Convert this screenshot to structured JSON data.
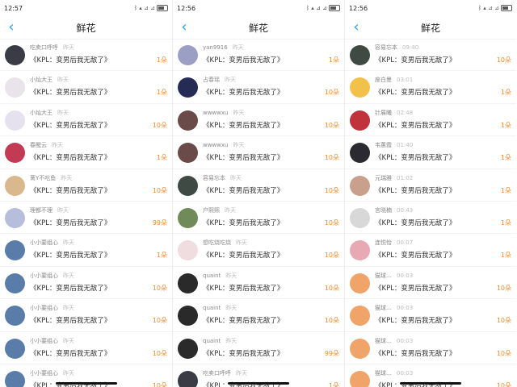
{
  "screens": [
    {
      "status_time": "12:57",
      "status_icons": "ᛒ ▴ ⊿ ⊿",
      "page_title": "鲜花",
      "items": [
        {
          "user": "吃卖口呼呼",
          "time": "昨天",
          "message": "《KPL：变男后我无敌了》",
          "amount": "1朵",
          "avatar_color": "#3b3b46"
        },
        {
          "user": "小灿大王",
          "time": "昨天",
          "message": "《KPL：变男后我无敌了》",
          "amount": "1朵",
          "avatar_color": "#e9e3ea"
        },
        {
          "user": "小灿大王",
          "time": "昨天",
          "message": "《KPL：变男后我无敌了》",
          "amount": "10朵",
          "avatar_color": "#e6e1ee"
        },
        {
          "user": "春醒云",
          "time": "昨天",
          "message": "《KPL：变男后我无敌了》",
          "amount": "1朵",
          "avatar_color": "#c23a54"
        },
        {
          "user": "蓠Y不吃鱼",
          "time": "昨天",
          "message": "《KPL：变男后我无敌了》",
          "amount": "10朵",
          "avatar_color": "#d9b88d"
        },
        {
          "user": "理都不理",
          "time": "昨天",
          "message": "《KPL：变男后我无敌了》",
          "amount": "99朵",
          "avatar_color": "#b7bedb"
        },
        {
          "user": "小小要组心",
          "time": "昨天",
          "message": "《KPL：变男后我无敌了》",
          "amount": "1朵",
          "avatar_color": "#5a7ca8"
        },
        {
          "user": "小小要组心",
          "time": "昨天",
          "message": "《KPL：变男后我无敌了》",
          "amount": "10朵",
          "avatar_color": "#5a7ca8"
        },
        {
          "user": "小小要组心",
          "time": "昨天",
          "message": "《KPL：变男后我无敌了》",
          "amount": "10朵",
          "avatar_color": "#5a7ca8"
        },
        {
          "user": "小小要组心",
          "time": "昨天",
          "message": "《KPL：变男后我无敌了》",
          "amount": "10朵",
          "avatar_color": "#5a7ca8"
        },
        {
          "user": "小小要组心",
          "time": "昨天",
          "message": "《KPL：变男后我无敌了》",
          "amount": "10朵",
          "avatar_color": "#5a7ca8"
        }
      ]
    },
    {
      "status_time": "12:56",
      "status_icons": "ᛒ ▴ ⊿ ⊿",
      "page_title": "鲜花",
      "items": [
        {
          "user": "yan9916",
          "time": "昨天",
          "message": "《KPL：变男后我无敌了》",
          "amount": "1朵",
          "avatar_color": "#9b9fc4"
        },
        {
          "user": "占春瑶",
          "time": "昨天",
          "message": "《KPL：变男后我无敌了》",
          "amount": "10朵",
          "avatar_color": "#262b55"
        },
        {
          "user": "wwwwxu",
          "time": "昨天",
          "message": "《KPL：变男后我无敌了》",
          "amount": "10朵",
          "avatar_color": "#6b4a4a"
        },
        {
          "user": "wwwwxu",
          "time": "昨天",
          "message": "《KPL：变男后我无敌了》",
          "amount": "10朵",
          "avatar_color": "#6b4a4a"
        },
        {
          "user": "容易忘本",
          "time": "昨天",
          "message": "《KPL：变男后我无敌了》",
          "amount": "10朵",
          "avatar_color": "#3f4a45"
        },
        {
          "user": "户熙熙",
          "time": "昨天",
          "message": "《KPL：变男后我无敌了》",
          "amount": "10朵",
          "avatar_color": "#708a5a"
        },
        {
          "user": "想吃烧吃烧",
          "time": "昨天",
          "message": "《KPL：变男后我无敌了》",
          "amount": "10朵",
          "avatar_color": "#f0dde0"
        },
        {
          "user": "quaint",
          "time": "昨天",
          "message": "《KPL：变男后我无敌了》",
          "amount": "10朵",
          "avatar_color": "#2a2a2a"
        },
        {
          "user": "quaint",
          "time": "昨天",
          "message": "《KPL：变男后我无敌了》",
          "amount": "10朵",
          "avatar_color": "#2a2a2a"
        },
        {
          "user": "quaint",
          "time": "昨天",
          "message": "《KPL：变男后我无敌了》",
          "amount": "99朵",
          "avatar_color": "#2a2a2a"
        },
        {
          "user": "吃卖口呼呼",
          "time": "昨天",
          "message": "《KPL：变男后我无敌了》",
          "amount": "1朵",
          "avatar_color": "#3b3b46"
        }
      ]
    },
    {
      "status_time": "12:56",
      "status_icons": "ᛒ ▴ ⊿ ⊿",
      "page_title": "鲜花",
      "items": [
        {
          "user": "容易忘本",
          "time": "09:40",
          "message": "《KPL：变男后我无敌了》",
          "amount": "10朵",
          "avatar_color": "#3f4a45"
        },
        {
          "user": "座白曼",
          "time": "03:01",
          "message": "《KPL：变男后我无敌了》",
          "amount": "1朵",
          "avatar_color": "#f2c14a"
        },
        {
          "user": "针展曦",
          "time": "02:48",
          "message": "《KPL：变男后我无敌了》",
          "amount": "1朵",
          "avatar_color": "#c0323c"
        },
        {
          "user": "韦蕙霞",
          "time": "01:40",
          "message": "《KPL：变男后我无敌了》",
          "amount": "1朵",
          "avatar_color": "#2a2a30"
        },
        {
          "user": "元瑞雅",
          "time": "01:02",
          "message": "《KPL：变男后我无敌了》",
          "amount": "1朵",
          "avatar_color": "#c9a08c"
        },
        {
          "user": "言晓楠",
          "time": "00:43",
          "message": "《KPL：变男后我无敌了》",
          "amount": "1朵",
          "avatar_color": "#d8d8d8"
        },
        {
          "user": "连悦怡",
          "time": "00:07",
          "message": "《KPL：变男后我无敌了》",
          "amount": "1朵",
          "avatar_color": "#e7a9b4"
        },
        {
          "user": "猫球…",
          "time": "00:03",
          "message": "《KPL：变男后我无敌了》",
          "amount": "10朵",
          "avatar_color": "#f0a46a"
        },
        {
          "user": "猫球…",
          "time": "00:03",
          "message": "《KPL：变男后我无敌了》",
          "amount": "10朵",
          "avatar_color": "#f0a46a"
        },
        {
          "user": "猫球…",
          "time": "00:03",
          "message": "《KPL：变男后我无敌了》",
          "amount": "10朵",
          "avatar_color": "#f0a46a"
        },
        {
          "user": "猫球…",
          "time": "00:03",
          "message": "《KPL：变男后我无敌了》",
          "amount": "10朵",
          "avatar_color": "#f0a46a"
        }
      ]
    }
  ]
}
